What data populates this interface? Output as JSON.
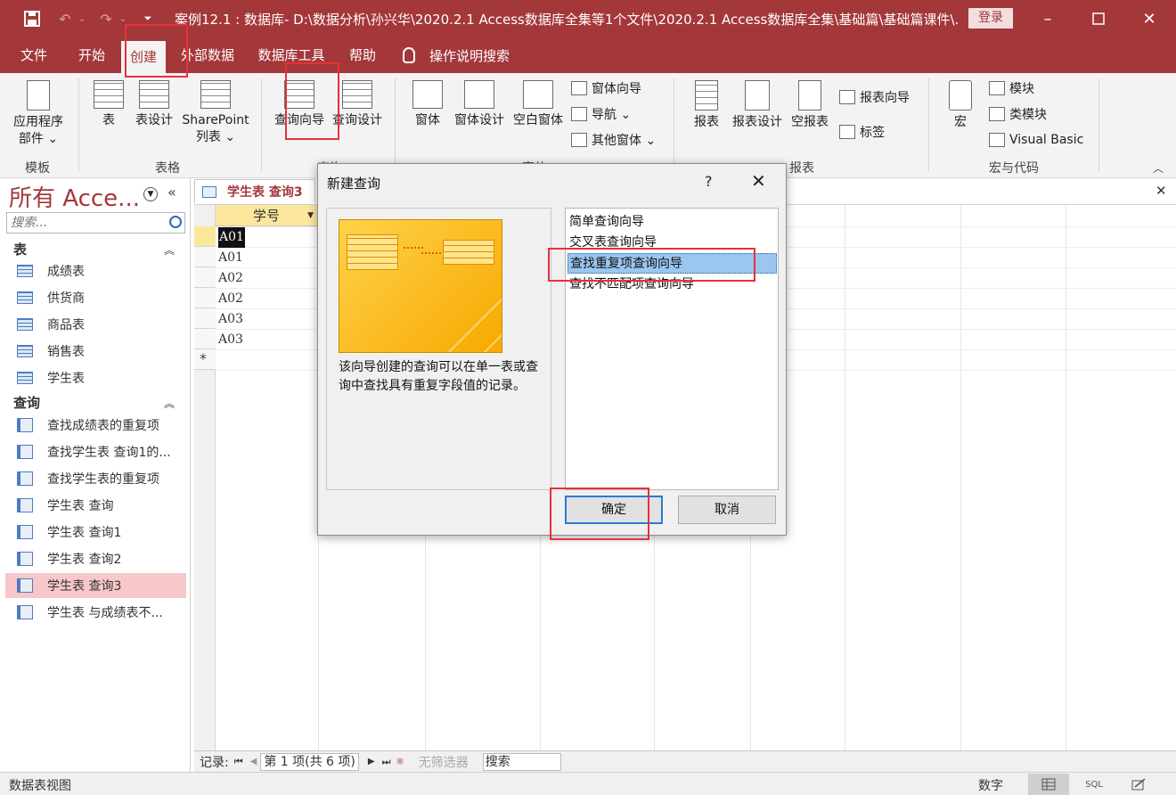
{
  "titlebar": {
    "title": "案例12.1 : 数据库- D:\\数据分析\\孙兴华\\2020.2.1 Access数据库全集等1个文件\\2020.2.1 Access数据库全集\\基础篇\\基础篇课件\\...",
    "login": "登录"
  },
  "menu": {
    "tabs": [
      "文件",
      "开始",
      "创建",
      "外部数据",
      "数据库工具",
      "帮助"
    ],
    "active_tab": "创建",
    "tell_me": "操作说明搜索"
  },
  "ribbon": {
    "template": {
      "app_parts_line1": "应用程序",
      "app_parts_line2": "部件 ⌄",
      "label": "模板"
    },
    "tables": {
      "table": "表",
      "table_design": "表设计",
      "sharepoint_line1": "SharePoint",
      "sharepoint_line2": "列表 ⌄",
      "label": "表格"
    },
    "queries": {
      "wizard": "查询向导",
      "design": "查询设计",
      "label": "查询"
    },
    "forms": {
      "form": "窗体",
      "form_design": "窗体设计",
      "blank_form": "空白窗体",
      "form_wizard": "窗体向导",
      "navigation": "导航 ⌄",
      "more_forms": "其他窗体 ⌄",
      "label": "窗体"
    },
    "reports": {
      "report": "报表",
      "report_design": "报表设计",
      "blank_report": "空报表",
      "report_wizard": "报表向导",
      "labels": "标签",
      "label": "报表"
    },
    "macros": {
      "macro": "宏",
      "module": "模块",
      "class_module": "类模块",
      "visual_basic": "Visual Basic",
      "label": "宏与代码"
    },
    "accent": "#a4373a"
  },
  "nav": {
    "title": "所有 Acce...",
    "search_placeholder": "搜索...",
    "tables_header": "表",
    "tables": [
      "成绩表",
      "供货商",
      "商品表",
      "销售表",
      "学生表"
    ],
    "queries_header": "查询",
    "queries": [
      "查找成绩表的重复项",
      "查找学生表 查询1的...",
      "查找学生表的重复项",
      "学生表 查询",
      "学生表 查询1",
      "学生表 查询2",
      "学生表 查询3",
      "学生表 与成绩表不..."
    ],
    "selected_query": "学生表 查询3"
  },
  "document": {
    "tab_label": "学生表 查询3",
    "column_header": "学号",
    "rows": [
      "A01",
      "A01",
      "A02",
      "A02",
      "A03",
      "A03"
    ],
    "new_row_marker": "*"
  },
  "record_nav": {
    "label": "记录:",
    "position": "第 1 项(共 6 项)",
    "filter": "无筛选器",
    "search": "搜索"
  },
  "status": {
    "left": "数据表视图",
    "numlock": "数字",
    "sql": "SQL"
  },
  "dialog": {
    "title": "新建查询",
    "help": "?",
    "description": "该向导创建的查询可以在单一表或查询中查找具有重复字段值的记录。",
    "options": [
      "简单查询向导",
      "交叉表查询向导",
      "查找重复项查询向导",
      "查找不匹配项查询向导"
    ],
    "selected_option": "查找重复项查询向导",
    "ok": "确定",
    "cancel": "取消"
  }
}
